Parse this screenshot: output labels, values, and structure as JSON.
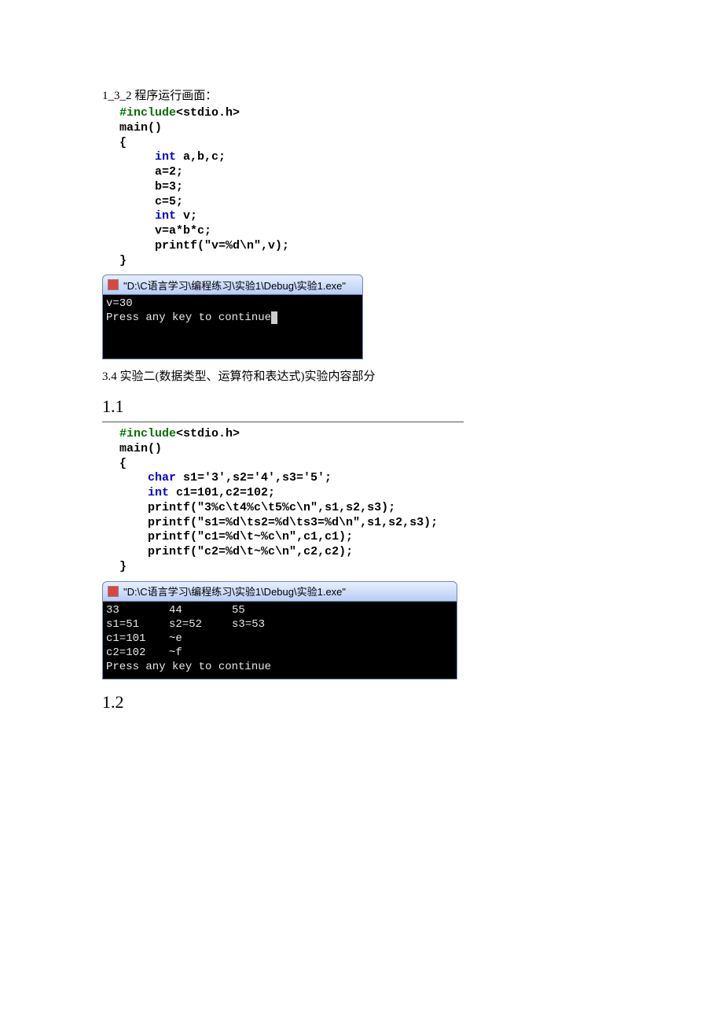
{
  "caption1": "1_3_2 程序运行画面：",
  "code1": {
    "l1a": "#include",
    "l1b": "<stdio.h>",
    "l2": "main()",
    "l3": "{",
    "l4a": "int",
    "l4b": " a,b,c;",
    "l5": "a=2;",
    "l6": "b=3;",
    "l7": "c=5;",
    "l8a": "int",
    "l8b": " v;",
    "l9": "v=a*b*c;",
    "l10a": "printf(",
    "l10b": "\"v=%d\\n\"",
    "l10c": ",v);",
    "l11": "}"
  },
  "win1": {
    "title": "\"D:\\C语言学习\\编程练习\\实验1\\Debug\\实验1.exe\"",
    "line1": "v=30",
    "line2": "Press any key to continue",
    "cursor": "_"
  },
  "sec34": "3.4      实验二(数据类型、运算符和表达式)实验内容部分",
  "sec11": "1.1",
  "code2": {
    "l1a": "#include",
    "l1b": "<stdio.h>",
    "l2": "main()",
    "l3": "{",
    "l4a": "char",
    "l4b": " s1='3',s2='4',s3='5';",
    "l5a": "int",
    "l5b": " c1=101,c2=102;",
    "l6a": "printf(",
    "l6b": "\"3%c\\t4%c\\t5%c\\n\"",
    "l6c": ",s1,s2,s3);",
    "l7a": "printf(",
    "l7b": "\"s1=%d\\ts2=%d\\ts3=%d\\n\"",
    "l7c": ",s1,s2,s3);",
    "l8a": "printf(",
    "l8b": "\"c1=%d\\t~%c\\n\"",
    "l8c": ",c1,c1);",
    "l9a": "printf(",
    "l9b": "\"c2=%d\\t~%c\\n\"",
    "l9c": ",c2,c2);",
    "l10": "}"
  },
  "win2": {
    "title": "\"D:\\C语言学习\\编程练习\\实验1\\Debug\\实验1.exe\"",
    "r1c1": "33",
    "r1c2": "44",
    "r1c3": "55",
    "r2c1": "s1=51",
    "r2c2": "s2=52",
    "r2c3": "s3=53",
    "r3c1": "c1=101",
    "r3c2": "~e",
    "r4c1": "c2=102",
    "r4c2": "~f",
    "r5": "Press any key to continue"
  },
  "sec12": "1.2"
}
